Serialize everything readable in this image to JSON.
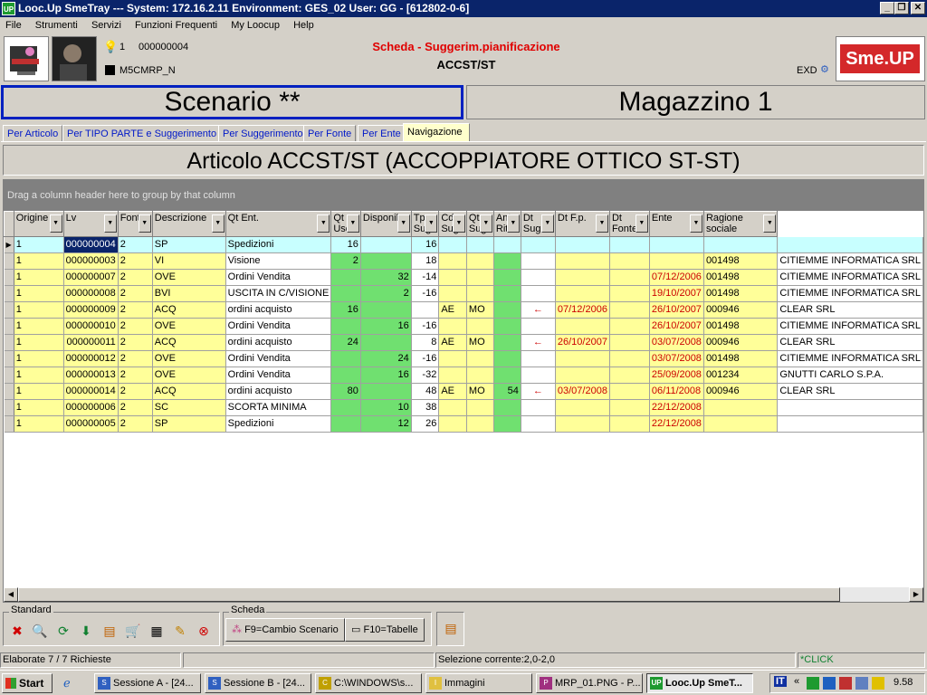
{
  "window": {
    "title": "Looc.Up SmeTray --- System: 172.16.2.11 Environment: GES_02 User: GG - [612802-0-6]",
    "app_icon": "UP"
  },
  "menu": [
    "File",
    "Strumenti",
    "Servizi",
    "Funzioni Frequenti",
    "My Loocup",
    "Help"
  ],
  "header": {
    "bulb_count": "1",
    "code": "000000004",
    "module": "M5CMRP_N",
    "title": "Scheda - Suggerim.pianificazione",
    "subtitle": "ACCST/ST",
    "exd": "EXD",
    "brand": "Sme.UP"
  },
  "scenario_label": "Scenario **",
  "magazzino_label": "Magazzino 1",
  "tabs": [
    "Per Articolo",
    "Per TIPO PARTE e Suggerimento",
    "Per Suggerimento",
    "Per Fonte",
    "Per Ente",
    "Navigazione"
  ],
  "article_title": "Articolo ACCST/ST (ACCOPPIATORE OTTICO ST-ST)",
  "group_hint": "Drag a column header here to group by that column",
  "columns": [
    "Origine",
    "Lv",
    "Fonte",
    "Descrizione",
    "Qt Ent.",
    "Qt Usc.",
    "Disponib.",
    "Tp Sug",
    "Cd Sug",
    "Qt Sug",
    "Ant. Rit.",
    "Dt Sug",
    "Dt F.p.",
    "Dt Fonte",
    "Ente",
    "Ragione sociale"
  ],
  "rows": [
    {
      "o1": "1",
      "o2": "000000004",
      "lv": "2",
      "fonte": "SP",
      "desc": "Spedizioni",
      "qe": "16",
      "qu": "",
      "disp": "16",
      "tp": "",
      "cd": "",
      "qs": "",
      "ant": "",
      "dts": "",
      "dtfp": "",
      "dtf": "",
      "ente": "",
      "rag": ""
    },
    {
      "o1": "1",
      "o2": "000000003",
      "lv": "2",
      "fonte": "VI",
      "desc": "Visione",
      "qe": "2",
      "qu": "",
      "disp": "18",
      "tp": "",
      "cd": "",
      "qs": "",
      "ant": "",
      "dts": "",
      "dtfp": "",
      "dtf": "",
      "ente": "001498",
      "rag": "CITIEMME INFORMATICA SRL"
    },
    {
      "o1": "1",
      "o2": "000000007",
      "lv": "2",
      "fonte": "OVE",
      "desc": "Ordini Vendita",
      "qe": "",
      "qu": "32",
      "disp": "-14",
      "tp": "",
      "cd": "",
      "qs": "",
      "ant": "",
      "dts": "",
      "dtfp": "",
      "dtf": "07/12/2006",
      "ente": "001498",
      "rag": "CITIEMME INFORMATICA SRL"
    },
    {
      "o1": "1",
      "o2": "000000008",
      "lv": "2",
      "fonte": "BVI",
      "desc": "USCITA IN  C/VISIONE",
      "qe": "",
      "qu": "2",
      "disp": "-16",
      "tp": "",
      "cd": "",
      "qs": "",
      "ant": "",
      "dts": "",
      "dtfp": "",
      "dtf": "19/10/2007",
      "ente": "001498",
      "rag": "CITIEMME INFORMATICA SRL"
    },
    {
      "o1": "1",
      "o2": "000000009",
      "lv": "2",
      "fonte": "ACQ",
      "desc": "ordini acquisto",
      "qe": "16",
      "qu": "",
      "disp": "",
      "tp": "AE",
      "cd": "MO",
      "qs": "",
      "ant": "←",
      "dts": "07/12/2006",
      "dtfp": "",
      "dtf": "26/10/2007",
      "ente": "000946",
      "rag": "CLEAR SRL"
    },
    {
      "o1": "1",
      "o2": "000000010",
      "lv": "2",
      "fonte": "OVE",
      "desc": "Ordini Vendita",
      "qe": "",
      "qu": "16",
      "disp": "-16",
      "tp": "",
      "cd": "",
      "qs": "",
      "ant": "",
      "dts": "",
      "dtfp": "",
      "dtf": "26/10/2007",
      "ente": "001498",
      "rag": "CITIEMME INFORMATICA SRL"
    },
    {
      "o1": "1",
      "o2": "000000011",
      "lv": "2",
      "fonte": "ACQ",
      "desc": "ordini acquisto",
      "qe": "24",
      "qu": "",
      "disp": "8",
      "tp": "AE",
      "cd": "MO",
      "qs": "",
      "ant": "←",
      "dts": "26/10/2007",
      "dtfp": "",
      "dtf": "03/07/2008",
      "ente": "000946",
      "rag": "CLEAR SRL"
    },
    {
      "o1": "1",
      "o2": "000000012",
      "lv": "2",
      "fonte": "OVE",
      "desc": "Ordini Vendita",
      "qe": "",
      "qu": "24",
      "disp": "-16",
      "tp": "",
      "cd": "",
      "qs": "",
      "ant": "",
      "dts": "",
      "dtfp": "",
      "dtf": "03/07/2008",
      "ente": "001498",
      "rag": "CITIEMME INFORMATICA SRL"
    },
    {
      "o1": "1",
      "o2": "000000013",
      "lv": "2",
      "fonte": "OVE",
      "desc": "Ordini Vendita",
      "qe": "",
      "qu": "16",
      "disp": "-32",
      "tp": "",
      "cd": "",
      "qs": "",
      "ant": "",
      "dts": "",
      "dtfp": "",
      "dtf": "25/09/2008",
      "ente": "001234",
      "rag": "GNUTTI CARLO S.P.A."
    },
    {
      "o1": "1",
      "o2": "000000014",
      "lv": "2",
      "fonte": "ACQ",
      "desc": "ordini acquisto",
      "qe": "80",
      "qu": "",
      "disp": "48",
      "tp": "AE",
      "cd": "MO",
      "qs": "54",
      "ant": "←",
      "dts": "03/07/2008",
      "dtfp": "",
      "dtf": "06/11/2008",
      "ente": "000946",
      "rag": "CLEAR SRL"
    },
    {
      "o1": "1",
      "o2": "000000006",
      "lv": "2",
      "fonte": "SC",
      "desc": "SCORTA MINIMA",
      "qe": "",
      "qu": "10",
      "disp": "38",
      "tp": "",
      "cd": "",
      "qs": "",
      "ant": "",
      "dts": "",
      "dtfp": "",
      "dtf": "22/12/2008",
      "ente": "",
      "rag": ""
    },
    {
      "o1": "1",
      "o2": "000000005",
      "lv": "2",
      "fonte": "SP",
      "desc": "Spedizioni",
      "qe": "",
      "qu": "12",
      "disp": "26",
      "tp": "",
      "cd": "",
      "qs": "",
      "ant": "",
      "dts": "",
      "dtfp": "",
      "dtf": "22/12/2008",
      "ente": "",
      "rag": ""
    }
  ],
  "toolbar": {
    "standard_label": "Standard",
    "scheda_label": "Scheda",
    "icons": [
      "close-icon",
      "search-icon",
      "refresh-icon",
      "back-icon",
      "export-icon",
      "cart-icon",
      "chart-icon",
      "tools-icon",
      "stop-icon"
    ],
    "f9": "F9=Cambio Scenario",
    "f10": "F10=Tabelle"
  },
  "status": {
    "left": "Elaborate 7 / 7 Richieste",
    "selection": "Selezione corrente:2,0-2,0",
    "click": "*CLICK"
  },
  "taskbar": {
    "start": "Start",
    "tasks": [
      "Sessione A - [24...",
      "Sessione B - [24...",
      "C:\\WINDOWS\\s...",
      "Immagini",
      "MRP_01.PNG - P...",
      "Looc.Up SmeT..."
    ],
    "lang": "IT",
    "clock": "9.58"
  },
  "colors": {
    "title_bar": "#0a246a",
    "accent_red": "#e00000",
    "grid_yellow": "#ffff99",
    "grid_green": "#70e070",
    "scenario_border": "#0020c0"
  }
}
